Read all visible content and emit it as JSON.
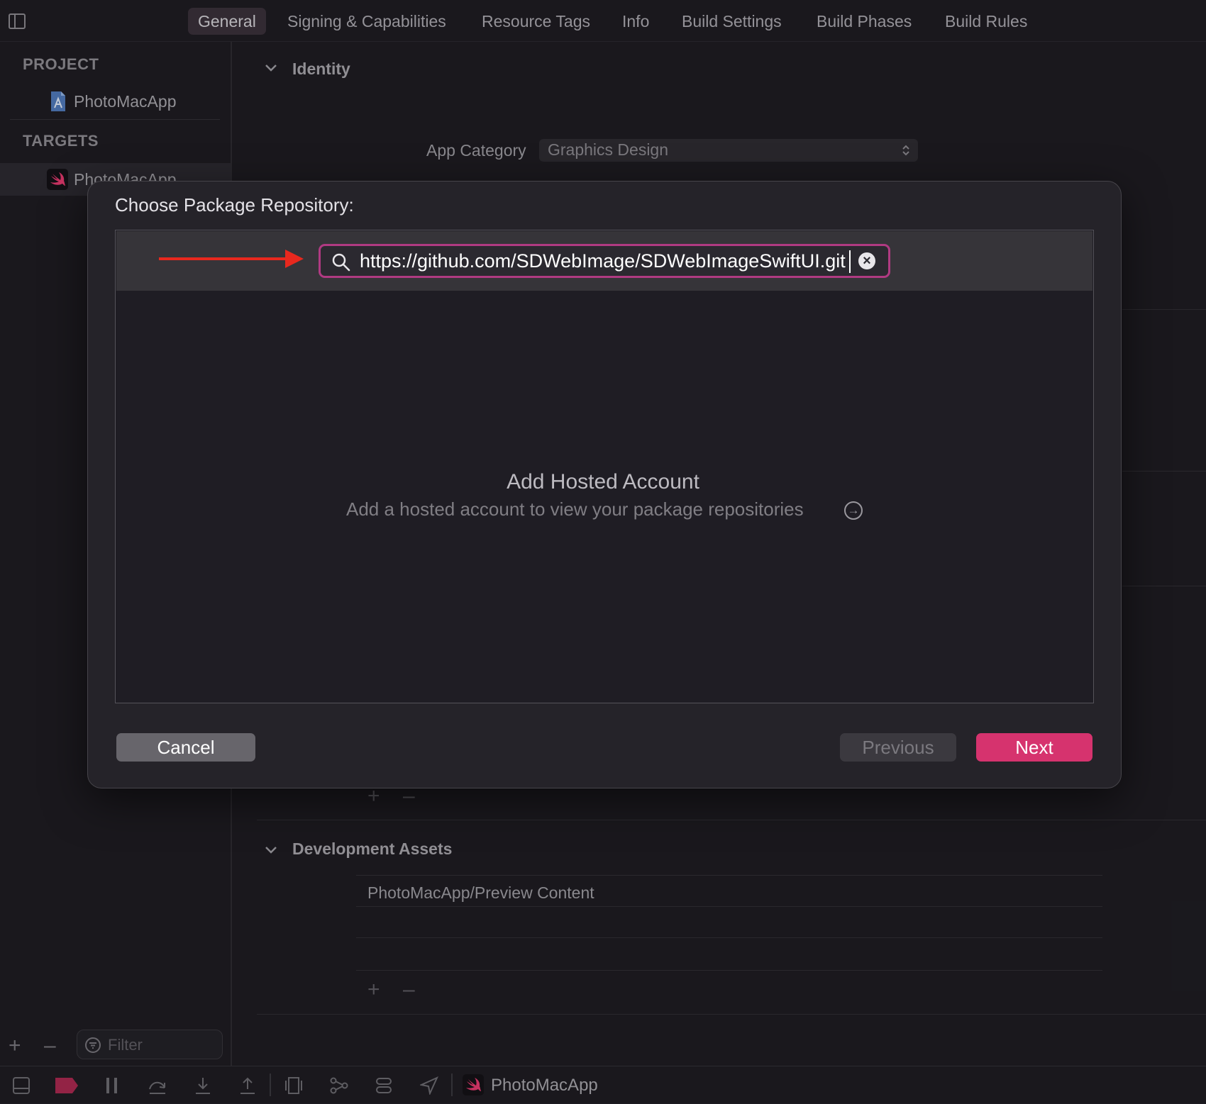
{
  "tabs": [
    {
      "label": "General",
      "active": true
    },
    {
      "label": "Signing & Capabilities",
      "active": false
    },
    {
      "label": "Resource Tags",
      "active": false
    },
    {
      "label": "Info",
      "active": false
    },
    {
      "label": "Build Settings",
      "active": false
    },
    {
      "label": "Build Phases",
      "active": false
    },
    {
      "label": "Build Rules",
      "active": false
    }
  ],
  "sidebar": {
    "project_header": "PROJECT",
    "project_name": "PhotoMacApp",
    "targets_header": "TARGETS",
    "target_name": "PhotoMacApp",
    "filter_placeholder": "Filter"
  },
  "main": {
    "identity_title": "Identity",
    "app_category_label": "App Category",
    "app_category_value": "Graphics Design",
    "dev_assets_title": "Development Assets",
    "dev_assets_path": "PhotoMacApp/Preview Content"
  },
  "modal": {
    "title": "Choose Package Repository:",
    "search_value": "https://github.com/SDWebImage/SDWebImageSwiftUI.git",
    "hosted_title": "Add Hosted Account",
    "hosted_desc": "Add a hosted account to view your package repositories",
    "cancel_label": "Cancel",
    "previous_label": "Previous",
    "next_label": "Next"
  },
  "bottombar": {
    "scheme_name": "PhotoMacApp"
  },
  "colors": {
    "accent": "#d6336e",
    "search_focus": "#b03a82",
    "annotation_arrow": "#e8281e"
  }
}
